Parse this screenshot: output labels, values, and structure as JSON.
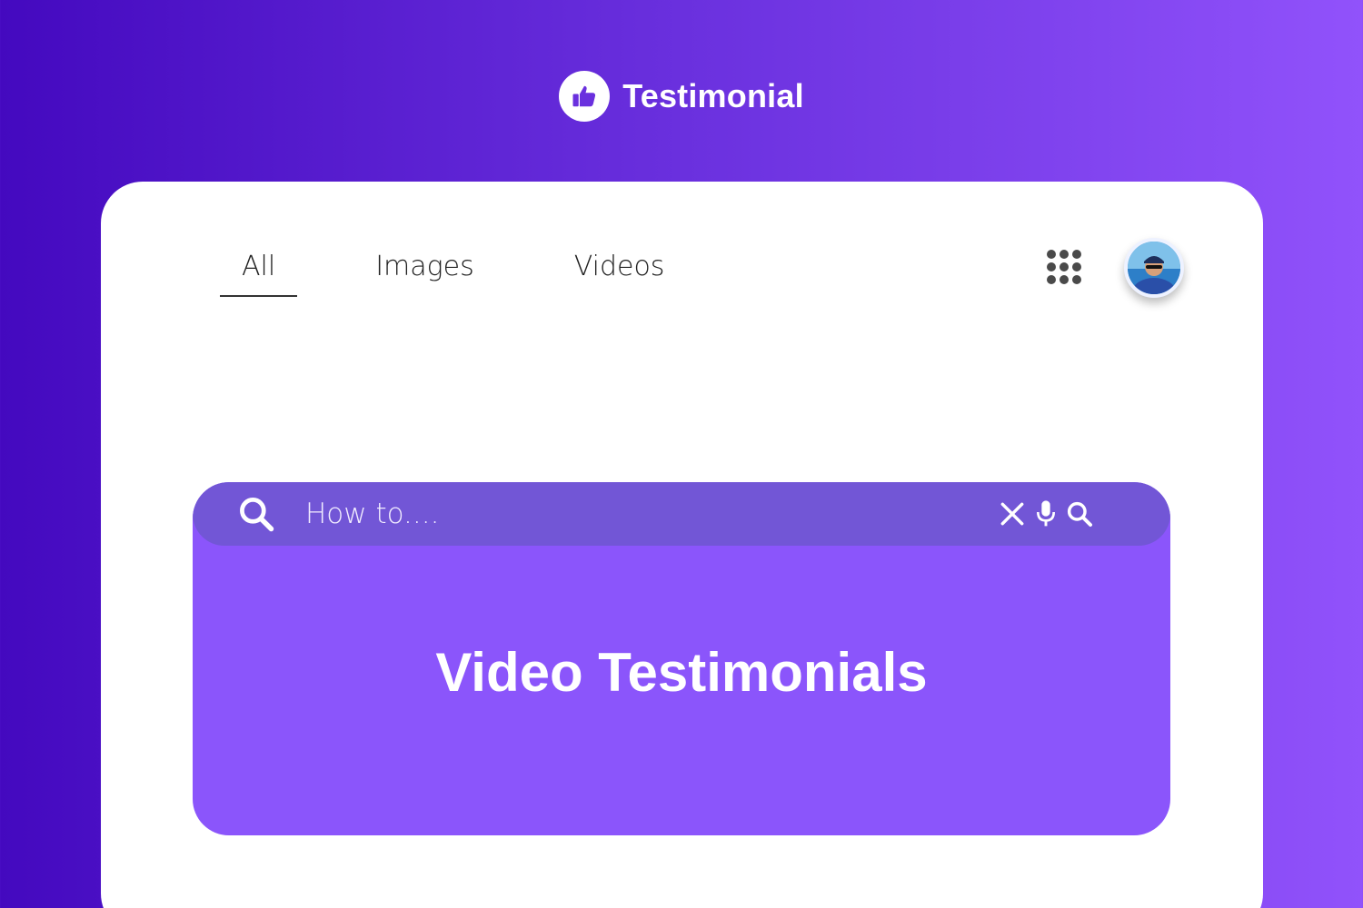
{
  "brand": {
    "name": "Testimonial",
    "logo_icon": "thumbs-up-icon"
  },
  "tabs": [
    {
      "label": "All",
      "active": true
    },
    {
      "label": "Images",
      "active": false
    },
    {
      "label": "Videos",
      "active": false
    }
  ],
  "header": {
    "apps_icon": "apps-grid-icon",
    "avatar_icon": "user-avatar"
  },
  "search": {
    "placeholder": "How to....",
    "value": "",
    "icons": [
      "search-icon",
      "close-icon",
      "microphone-icon",
      "search-icon"
    ]
  },
  "hero": {
    "title": "Video Testimonials"
  },
  "colors": {
    "gradient_start": "#4409bf",
    "gradient_end": "#9152fb",
    "hero_bg": "#8b55fb",
    "search_bg": "#7256d6",
    "card_bg": "#ffffff"
  }
}
